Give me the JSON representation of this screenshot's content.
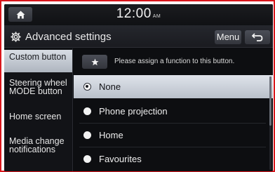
{
  "statusbar": {
    "time": "12:00",
    "ampm": "AM"
  },
  "header": {
    "title": "Advanced settings",
    "menu_label": "Menu"
  },
  "sidebar": {
    "items": [
      {
        "label": "Custom button"
      },
      {
        "label": "Steering wheel MODE button"
      },
      {
        "label": "Home screen"
      },
      {
        "label": "Media change notifications"
      }
    ]
  },
  "content": {
    "hint": "Please assign a function to this button.",
    "options": [
      {
        "label": "None",
        "selected": true
      },
      {
        "label": "Phone projection",
        "selected": false
      },
      {
        "label": "Home",
        "selected": false
      },
      {
        "label": "Favourites",
        "selected": false
      }
    ]
  },
  "icons": {
    "home": "home-icon",
    "settings": "gear-icon",
    "back": "back-arrow-icon",
    "star": "star-icon"
  },
  "colors": {
    "frame_border": "#d9161c",
    "background": "#0b0c0f",
    "selected_bg": "#dfe3ea"
  }
}
